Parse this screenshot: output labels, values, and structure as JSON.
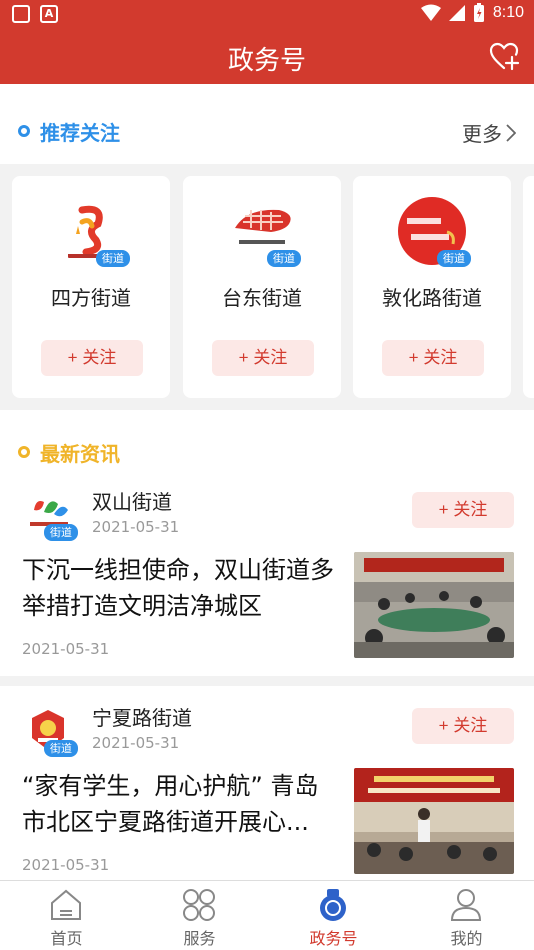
{
  "status": {
    "time": "8:10"
  },
  "header": {
    "title": "政务号"
  },
  "recommend": {
    "title": "推荐关注",
    "more": "更多",
    "tag": "街道",
    "cards": [
      {
        "name": "四方街道",
        "follow": "+ 关注"
      },
      {
        "name": "台东街道",
        "follow": "+ 关注"
      },
      {
        "name": "敦化路街道",
        "follow": "+ 关注"
      }
    ]
  },
  "news": {
    "title": "最新资讯",
    "tag": "街道",
    "items": [
      {
        "source": "双山街道",
        "source_date": "2021-05-31",
        "follow": "+ 关注",
        "headline": "下沉一线担使命，双山街道多举措打造文明洁净城区",
        "date": "2021-05-31"
      },
      {
        "source": "宁夏路街道",
        "source_date": "2021-05-31",
        "follow": "+ 关注",
        "headline": "“家有学生，用心护航” 青岛市北区宁夏路街道开展心...",
        "date": "2021-05-31"
      }
    ]
  },
  "tabs": [
    {
      "label": "首页"
    },
    {
      "label": "服务"
    },
    {
      "label": "政务号"
    },
    {
      "label": "我的"
    }
  ],
  "colors": {
    "brand": "#d23a2e",
    "accent_blue": "#2e90e8",
    "accent_yellow": "#f0b429"
  }
}
